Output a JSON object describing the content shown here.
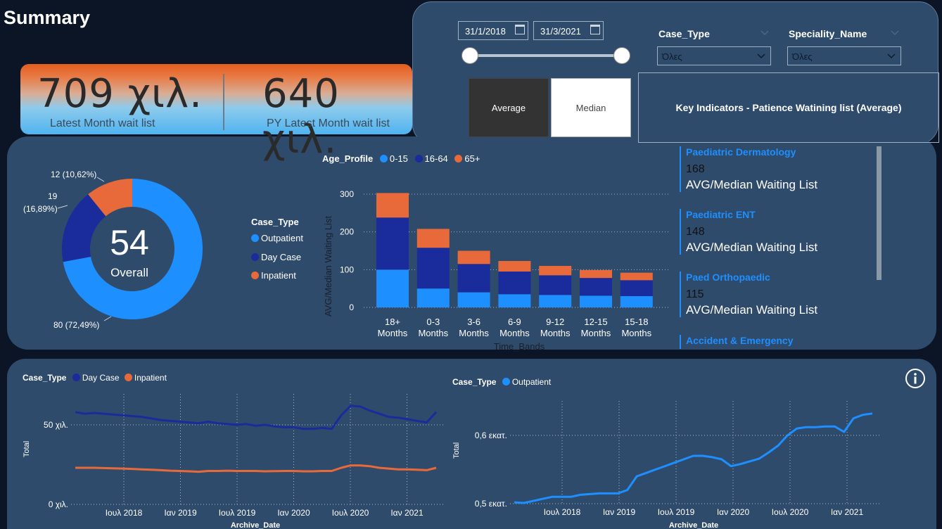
{
  "title": "Summary",
  "kpi": {
    "latest_value": "709 χιλ.",
    "latest_label": "Latest Month wait list",
    "py_value": "640 χιλ.",
    "py_label": "PY Latest Month wait list"
  },
  "filters": {
    "date_from": "31/1/2018",
    "date_to": "31/3/2021",
    "case_type_title": "Case_Type",
    "case_type_value": "Όλες",
    "speciality_title": "Speciality_Name",
    "speciality_value": "Όλες",
    "average_label": "Average",
    "median_label": "Median",
    "key_indicators_title": "Key Indicators - Patience Watining list (Average)"
  },
  "donut": {
    "center_value": "54",
    "center_label": "Overall",
    "legend_title": "Case_Type",
    "slices": [
      {
        "name": "Outpatient",
        "value": 80,
        "label": "80 (72,49%)",
        "color": "#1e8fff"
      },
      {
        "name": "Day Case",
        "value": 19,
        "label_line1": "19",
        "label_line2": "(16,89%)",
        "color": "#1a2b9b"
      },
      {
        "name": "Inpatient",
        "value": 12,
        "label": "12 (10,62%)",
        "color": "#e8693a"
      }
    ]
  },
  "bar_chart": {
    "legend_title": "Age_Profile",
    "xlabel": "Time_Bands",
    "ylabel": "AVG/Median Waiting List",
    "ylim": [
      0,
      300
    ],
    "yticks": [
      "0",
      "100",
      "200",
      "300"
    ],
    "categories": [
      [
        "18+",
        "Months"
      ],
      [
        "0-3",
        "Months"
      ],
      [
        "3-6",
        "Months"
      ],
      [
        "6-9",
        "Months"
      ],
      [
        "9-12",
        "Months"
      ],
      [
        "12-15",
        "Months"
      ],
      [
        "15-18",
        "Months"
      ]
    ],
    "series": [
      {
        "name": "0-15",
        "color": "#1e8fff",
        "values": [
          100,
          50,
          40,
          35,
          33,
          31,
          30
        ]
      },
      {
        "name": "16-64",
        "color": "#1a2b9b",
        "values": [
          138,
          108,
          75,
          60,
          52,
          47,
          42
        ]
      },
      {
        "name": "65+",
        "color": "#e8693a",
        "values": [
          65,
          50,
          35,
          28,
          25,
          21,
          20
        ]
      }
    ]
  },
  "specialities": [
    {
      "name": "Paediatric Dermatology",
      "value": "168",
      "label": "AVG/Median Waiting List"
    },
    {
      "name": "Paediatric ENT",
      "value": "148",
      "label": "AVG/Median Waiting List"
    },
    {
      "name": "Paed Orthopaedic",
      "value": "115",
      "label": "AVG/Median Waiting List"
    },
    {
      "name": "Accident & Emergency",
      "value": "",
      "label": ""
    }
  ],
  "chart_data": [
    {
      "type": "pie",
      "categories": [
        "Outpatient",
        "Day Case",
        "Inpatient"
      ],
      "values": [
        80,
        19,
        12
      ],
      "title": "",
      "center_text": "54 Overall"
    },
    {
      "type": "bar",
      "stacked": true,
      "categories": [
        "18+ Months",
        "0-3 Months",
        "3-6 Months",
        "6-9 Months",
        "9-12 Months",
        "12-15 Months",
        "15-18 Months"
      ],
      "series": [
        {
          "name": "0-15",
          "values": [
            100,
            50,
            40,
            35,
            33,
            31,
            30
          ]
        },
        {
          "name": "16-64",
          "values": [
            138,
            108,
            75,
            60,
            52,
            47,
            42
          ]
        },
        {
          "name": "65+",
          "values": [
            65,
            50,
            35,
            28,
            25,
            21,
            20
          ]
        }
      ],
      "xlabel": "Time_Bands",
      "ylabel": "AVG/Median Waiting List",
      "ylim": [
        0,
        300
      ]
    },
    {
      "type": "line",
      "legend_title": "Case_Type",
      "xlabel": "Archive_Date",
      "ylabel": "Total",
      "xticks": [
        "Ιουλ 2018",
        "Ιαν 2019",
        "Ιουλ 2019",
        "Ιαν 2020",
        "Ιουλ 2020",
        "Ιαν 2021"
      ],
      "yticks": [
        "0 χιλ.",
        "50 χιλ."
      ],
      "x": [
        "2018-01",
        "2018-02",
        "2018-03",
        "2018-04",
        "2018-05",
        "2018-06",
        "2018-07",
        "2018-08",
        "2018-09",
        "2018-10",
        "2018-11",
        "2018-12",
        "2019-01",
        "2019-02",
        "2019-03",
        "2019-04",
        "2019-05",
        "2019-06",
        "2019-07",
        "2019-08",
        "2019-09",
        "2019-10",
        "2019-11",
        "2019-12",
        "2020-01",
        "2020-02",
        "2020-03",
        "2020-04",
        "2020-05",
        "2020-06",
        "2020-07",
        "2020-08",
        "2020-09",
        "2020-10",
        "2020-11",
        "2020-12",
        "2021-01",
        "2021-02",
        "2021-03"
      ],
      "series": [
        {
          "name": "Day Case",
          "color": "#1a2b9b",
          "values": [
            58,
            57,
            57.5,
            57,
            56.5,
            56,
            55.5,
            55,
            54,
            53,
            52.5,
            52,
            51.5,
            51,
            52,
            51,
            50.5,
            50,
            50.5,
            49.5,
            50,
            49,
            48.5,
            48.5,
            47.5,
            47.5,
            48,
            47.5,
            56,
            62,
            61.5,
            59,
            57,
            55,
            54.5,
            53.5,
            52.5,
            51.5,
            58
          ]
        },
        {
          "name": "Inpatient",
          "color": "#e8693a",
          "values": [
            23,
            23,
            23,
            22.8,
            22.7,
            22.5,
            22.3,
            22,
            21.8,
            21.5,
            21.2,
            21,
            20.8,
            20.5,
            21,
            21,
            21.2,
            21,
            21,
            21,
            20.8,
            20.9,
            21,
            21,
            20.8,
            20.8,
            21,
            21,
            23,
            24.5,
            24.5,
            24,
            23,
            22.5,
            22,
            22,
            21.8,
            21.5,
            23
          ]
        }
      ],
      "ylim": [
        0,
        65
      ]
    },
    {
      "type": "line",
      "legend_title": "Case_Type",
      "xlabel": "Archive_Date",
      "ylabel": "Total",
      "xticks": [
        "Ιουλ 2018",
        "Ιαν 2019",
        "Ιουλ 2019",
        "Ιαν 2020",
        "Ιουλ 2020",
        "Ιαν 2021"
      ],
      "yticks": [
        "0,5 εκατ.",
        "0,6 εκατ."
      ],
      "x": [
        "2018-01",
        "2018-02",
        "2018-03",
        "2018-04",
        "2018-05",
        "2018-06",
        "2018-07",
        "2018-08",
        "2018-09",
        "2018-10",
        "2018-11",
        "2018-12",
        "2019-01",
        "2019-02",
        "2019-03",
        "2019-04",
        "2019-05",
        "2019-06",
        "2019-07",
        "2019-08",
        "2019-09",
        "2019-10",
        "2019-11",
        "2019-12",
        "2020-01",
        "2020-02",
        "2020-03",
        "2020-04",
        "2020-05",
        "2020-06",
        "2020-07",
        "2020-08",
        "2020-09",
        "2020-10",
        "2020-11",
        "2020-12",
        "2021-01",
        "2021-02",
        "2021-03"
      ],
      "series": [
        {
          "name": "Outpatient",
          "color": "#1e8fff",
          "values": [
            0.502,
            0.501,
            0.504,
            0.507,
            0.51,
            0.51,
            0.51,
            0.513,
            0.514,
            0.515,
            0.515,
            0.515,
            0.52,
            0.54,
            0.545,
            0.55,
            0.555,
            0.56,
            0.565,
            0.57,
            0.57,
            0.568,
            0.565,
            0.555,
            0.558,
            0.562,
            0.566,
            0.575,
            0.585,
            0.6,
            0.61,
            0.612,
            0.612,
            0.613,
            0.613,
            0.605,
            0.625,
            0.63,
            0.632
          ]
        }
      ],
      "ylim": [
        0.5,
        0.63
      ]
    }
  ],
  "line_left": {
    "legend_title": "Case_Type",
    "xlabel": "Archive_Date",
    "ylabel": "Total",
    "xticks": [
      "Ιουλ 2018",
      "Ιαν 2019",
      "Ιουλ 2019",
      "Ιαν 2020",
      "Ιουλ 2020",
      "Ιαν 2021"
    ],
    "yticks": [
      "0 χιλ.",
      "50 χιλ."
    ]
  },
  "line_right": {
    "legend_title": "Case_Type",
    "xlabel": "Archive_Date",
    "ylabel": "Total",
    "xticks": [
      "Ιουλ 2018",
      "Ιαν 2019",
      "Ιουλ 2019",
      "Ιαν 2020",
      "Ιουλ 2020",
      "Ιαν 2021"
    ],
    "yticks": [
      "0,5 εκατ.",
      "0,6 εκατ."
    ]
  },
  "icons": {
    "info": "info-icon",
    "calendar": "calendar-icon",
    "dropdown": "chevron-down-icon"
  }
}
